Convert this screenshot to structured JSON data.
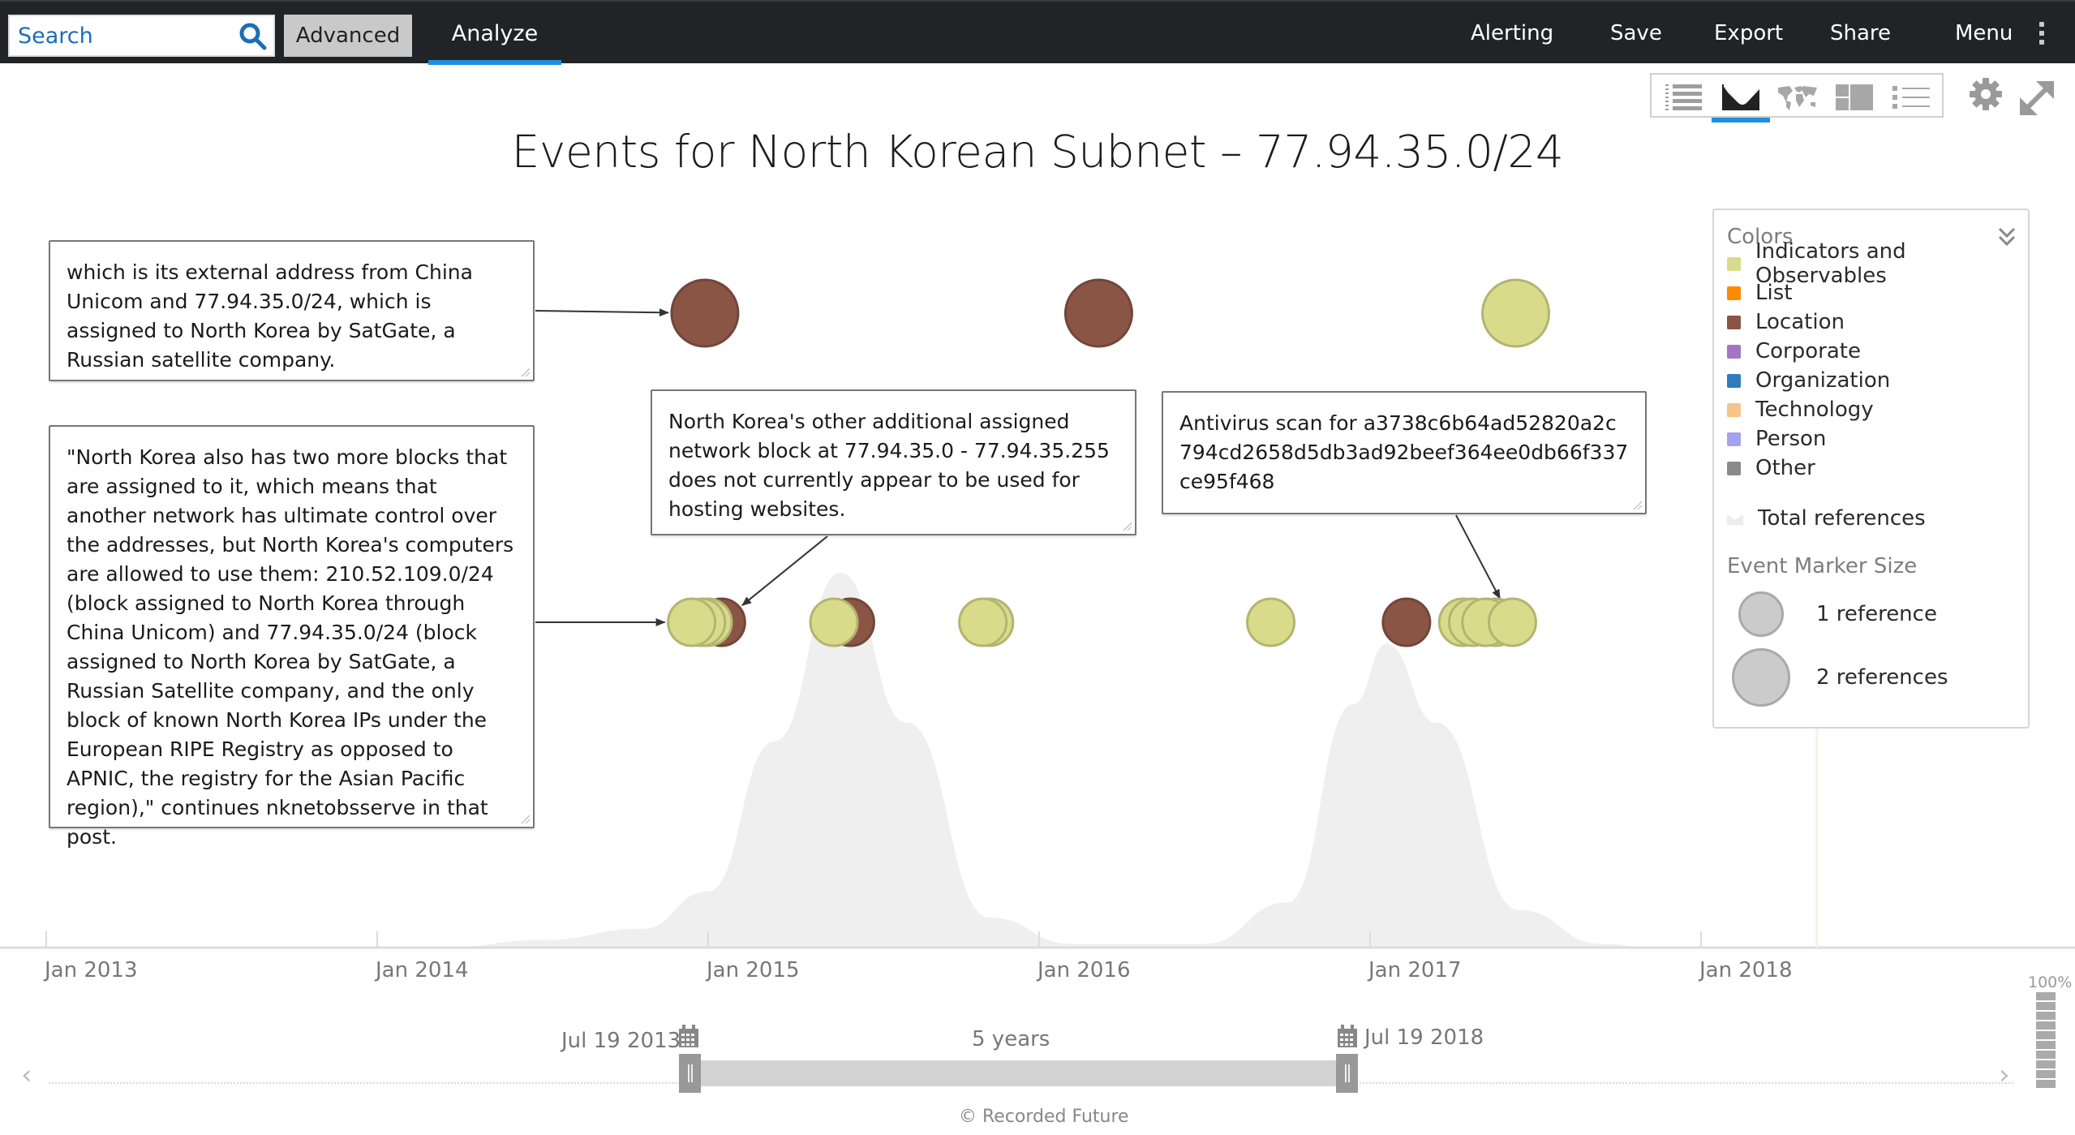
{
  "topbar": {
    "search_placeholder": "Search",
    "advanced_label": "Advanced",
    "analyze_label": "Analyze",
    "nav": [
      "Alerting",
      "Save",
      "Export",
      "Share",
      "Menu"
    ]
  },
  "view_toolbar": {
    "views": [
      "table-view",
      "timeline-view",
      "map-view",
      "panels-view",
      "list-view"
    ],
    "active": "timeline-view"
  },
  "title": "Events for North Korean Subnet – 77.94.35.0/24",
  "annotations": [
    {
      "text": "which is its external address from China Unicom and 77.94.35.0/24, which is assigned to North Korea by SatGate, a Russian satellite company."
    },
    {
      "text": "\"North Korea also has two more blocks that are assigned to it, which means that another network has ultimate control over the addresses, but North Korea's computers are allowed to use them: 210.52.109.0/24 (block assigned to North Korea through China Unicom) and 77.94.35.0/24 (block assigned to North Korea by SatGate, a Russian Satellite company, and the only block of known North Korea IPs under the European RIPE Registry as opposed to APNIC, the registry for the Asian Pacific region),\" continues nknetobsserve in that post."
    },
    {
      "text": "North Korea's other additional assigned network block at 77.94.35.0 - 77.94.35.255 does not currently appear to be used for hosting websites."
    },
    {
      "text": "Antivirus scan for a3738c6b64ad52820a2c794cd2658d5db3ad92beef364ee0db66f337ce95f468"
    }
  ],
  "legend": {
    "colors_heading": "Colors",
    "categories": [
      {
        "label": "Indicators and Observables",
        "color": "#d9db8a"
      },
      {
        "label": "List",
        "color": "#ff8a00"
      },
      {
        "label": "Location",
        "color": "#8b5545"
      },
      {
        "label": "Corporate",
        "color": "#a176c4"
      },
      {
        "label": "Organization",
        "color": "#2f7bc2"
      },
      {
        "label": "Technology",
        "color": "#f7c48a"
      },
      {
        "label": "Person",
        "color": "#a3a3f0"
      },
      {
        "label": "Other",
        "color": "#8a8a8a"
      }
    ],
    "total_label": "Total references",
    "size_heading": "Event Marker Size",
    "sizes": [
      {
        "label": "1 reference",
        "refs": 1
      },
      {
        "label": "2 references",
        "refs": 2
      }
    ]
  },
  "chart_data": {
    "type": "scatter",
    "title": "Events for North Korean Subnet – 77.94.35.0/24",
    "x_axis": {
      "ticks": [
        "Jan 2013",
        "Jan 2014",
        "Jan 2015",
        "Jan 2016",
        "Jan 2017",
        "Jan 2018"
      ],
      "range": [
        2013.0,
        2018.6
      ]
    },
    "today_marker": 2018.35,
    "rows": [
      "upper",
      "lower"
    ],
    "events": [
      {
        "date": 2014.99,
        "row": "upper",
        "category": "Location",
        "refs": 2,
        "annotation": 1
      },
      {
        "date": 2016.18,
        "row": "upper",
        "category": "Location",
        "refs": 2
      },
      {
        "date": 2017.44,
        "row": "upper",
        "category": "Indicators and Observables",
        "refs": 2
      },
      {
        "date": 2015.04,
        "row": "lower",
        "category": "Location",
        "refs": 1,
        "annotation": 3
      },
      {
        "date": 2015.0,
        "row": "lower",
        "category": "Indicators and Observables",
        "refs": 1
      },
      {
        "date": 2014.98,
        "row": "lower",
        "category": "Indicators and Observables",
        "refs": 1
      },
      {
        "date": 2014.95,
        "row": "lower",
        "category": "Indicators and Observables",
        "refs": 1,
        "annotation": 2
      },
      {
        "date": 2015.43,
        "row": "lower",
        "category": "Location",
        "refs": 1
      },
      {
        "date": 2015.38,
        "row": "lower",
        "category": "Indicators and Observables",
        "refs": 1
      },
      {
        "date": 2015.85,
        "row": "lower",
        "category": "Indicators and Observables",
        "refs": 1
      },
      {
        "date": 2015.83,
        "row": "lower",
        "category": "Indicators and Observables",
        "refs": 1
      },
      {
        "date": 2016.7,
        "row": "lower",
        "category": "Indicators and Observables",
        "refs": 1
      },
      {
        "date": 2017.11,
        "row": "lower",
        "category": "Location",
        "refs": 1
      },
      {
        "date": 2017.38,
        "row": "lower",
        "category": "Indicators and Observables",
        "refs": 1
      },
      {
        "date": 2017.28,
        "row": "lower",
        "category": "Indicators and Observables",
        "refs": 1
      },
      {
        "date": 2017.31,
        "row": "lower",
        "category": "Indicators and Observables",
        "refs": 1
      },
      {
        "date": 2017.35,
        "row": "lower",
        "category": "Indicators and Observables",
        "refs": 1
      },
      {
        "date": 2017.43,
        "row": "lower",
        "category": "Indicators and Observables",
        "refs": 1,
        "annotation": 4
      }
    ],
    "density": [
      {
        "x": 2013.0,
        "y": 0
      },
      {
        "x": 2014.2,
        "y": 0
      },
      {
        "x": 2014.5,
        "y": 0.02
      },
      {
        "x": 2014.8,
        "y": 0.05
      },
      {
        "x": 2015.0,
        "y": 0.15
      },
      {
        "x": 2015.2,
        "y": 0.55
      },
      {
        "x": 2015.4,
        "y": 1.0
      },
      {
        "x": 2015.6,
        "y": 0.6
      },
      {
        "x": 2015.85,
        "y": 0.08
      },
      {
        "x": 2016.1,
        "y": 0.01
      },
      {
        "x": 2016.5,
        "y": 0.01
      },
      {
        "x": 2016.75,
        "y": 0.12
      },
      {
        "x": 2016.95,
        "y": 0.65
      },
      {
        "x": 2017.05,
        "y": 0.81
      },
      {
        "x": 2017.2,
        "y": 0.6
      },
      {
        "x": 2017.45,
        "y": 0.1
      },
      {
        "x": 2017.7,
        "y": 0.01
      },
      {
        "x": 2017.85,
        "y": 0
      }
    ]
  },
  "time_range": {
    "start_label": "Jul 19 2013",
    "end_label": "Jul 19 2018",
    "duration_label": "5 years",
    "prev_label": "‹",
    "next_label": "›"
  },
  "zoom": {
    "label": "100%",
    "level": 1.0
  },
  "footer": {
    "copyright": "© Recorded Future"
  }
}
